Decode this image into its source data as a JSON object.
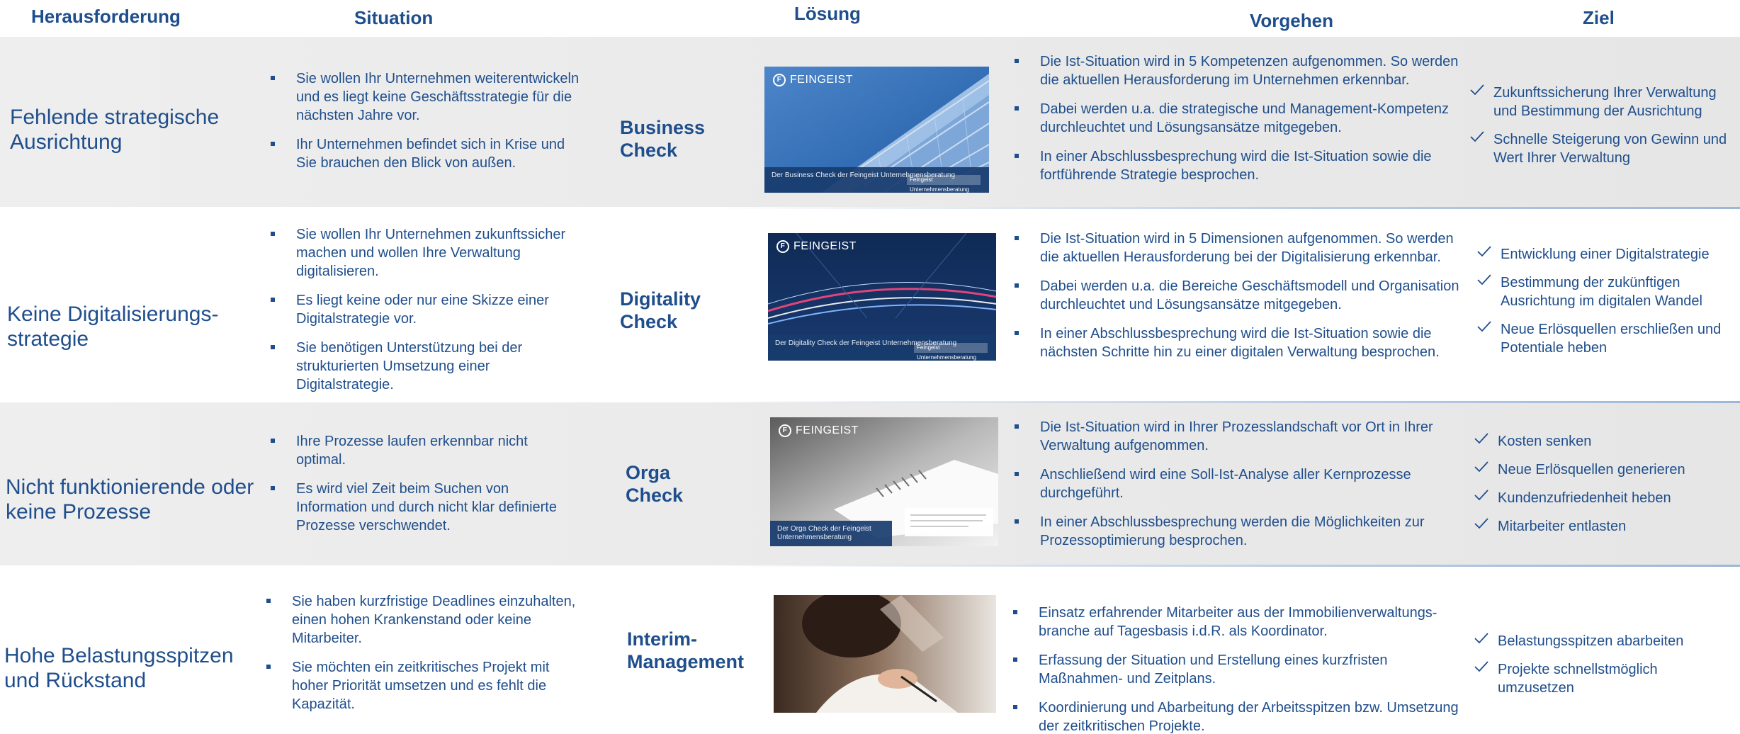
{
  "headers": {
    "challenge": "Herausforderung",
    "situation": "Situation",
    "solution": "Lösung",
    "approach": "Vorgehen",
    "goal": "Ziel"
  },
  "rows": [
    {
      "challenge": "Fehlende strategische Ausrichtung",
      "situation": [
        "Sie wollen Ihr Unternehmen weiterentwickeln und es liegt keine Geschäftsstrategie für die nächsten Jahre vor.",
        "Ihr Unternehmen befindet sich in Krise und Sie brauchen den Blick von außen."
      ],
      "solution": "Business Check",
      "thumbnail": {
        "logo": "FEINGEIST",
        "caption": "Der Business Check der Feingeist Unternehmensberatung",
        "button": "Feingeist Unternehmensberatung"
      },
      "approach": [
        "Die Ist-Situation wird in 5 Kompetenzen aufgenommen. So werden die aktuellen Herausforderung im Unternehmen erkennbar.",
        "Dabei werden u.a. die strategische und Management-Kompetenz durchleuchtet und Lösungsansätze mitgegeben.",
        "In einer Abschlussbesprechung wird die Ist-Situation sowie die fortführende Strategie besprochen."
      ],
      "goals": [
        "Zukunftssicherung Ihrer Verwaltung und Bestimmung der Ausrichtung",
        "Schnelle Steigerung von Gewinn und Wert Ihrer Verwaltung"
      ]
    },
    {
      "challenge": "Keine Digitalisierungs-strategie",
      "situation": [
        "Sie wollen Ihr Unternehmen zukunftssicher machen und wollen Ihre Verwaltung digitalisieren.",
        "Es liegt keine oder nur eine Skizze einer Digitalstrategie vor.",
        "Sie benötigen Unterstützung bei der strukturierten Umsetzung einer Digitalstrategie."
      ],
      "solution": "Digitality Check",
      "thumbnail": {
        "logo": "FEINGEIST",
        "caption": "Der Digitality Check der Feingeist Unternehmensberatung",
        "button": "Feingeist Unternehmensberatung"
      },
      "approach": [
        "Die Ist-Situation wird in 5 Dimensionen aufgenommen. So werden die aktuellen Herausforderung bei der Digitalisierung erkennbar.",
        "Dabei werden u.a. die Bereiche Geschäftsmodell und Organisation durchleuchtet und Lösungsansätze mitgegeben.",
        "In einer Abschlussbesprechung wird die Ist-Situation sowie die nächsten Schritte hin zu einer digitalen Verwaltung besprochen."
      ],
      "goals": [
        "Entwicklung einer Digitalstrategie",
        "Bestimmung der zukünftigen Ausrichtung im digitalen Wandel",
        "Neue Erlösquellen erschließen und Potentiale heben"
      ]
    },
    {
      "challenge": "Nicht funktionierende oder keine Prozesse",
      "situation": [
        "Ihre Prozesse laufen erkennbar nicht optimal.",
        "Es wird viel Zeit beim Suchen von Information und durch nicht klar definierte Prozesse verschwendet."
      ],
      "solution": "Orga Check",
      "thumbnail": {
        "logo": "FEINGEIST",
        "caption": "Der Orga Check der Feingeist Unternehmensberatung",
        "button": ""
      },
      "approach": [
        "Die Ist-Situation wird in Ihrer Prozesslandschaft vor Ort in Ihrer Verwaltung aufgenommen.",
        "Anschließend wird eine Soll-Ist-Analyse aller Kernprozesse durchgeführt.",
        "In einer Abschlussbesprechung werden die Möglichkeiten zur Prozessoptimierung besprochen."
      ],
      "goals": [
        "Kosten senken",
        "Neue Erlösquellen generieren",
        "Kundenzufriedenheit heben",
        "Mitarbeiter entlasten"
      ]
    },
    {
      "challenge": "Hohe Belastungsspitzen und Rückstand",
      "situation": [
        "Sie haben kurzfristige Deadlines einzuhalten, einen hohen Krankenstand oder keine Mitarbeiter.",
        "Sie möchten ein zeitkritisches Projekt mit hoher Priorität umsetzen und es fehlt die Kapazität."
      ],
      "solution": "Interim-Management",
      "approach": [
        "Einsatz erfahrender Mitarbeiter aus der Immobilienverwaltungs-branche auf Tagesbasis i.d.R. als Koordinator.",
        "Erfassung der Situation und Erstellung eines kurzfristen Maßnahmen- und Zeitplans.",
        "Koordinierung und Abarbeitung der Arbeitsspitzen bzw. Umsetzung der zeitkritischen Projekte."
      ],
      "goals": [
        "Belastungsspitzen abarbeiten",
        "Projekte schnellstmöglich umzusetzen"
      ]
    }
  ],
  "colors": {
    "text": "#1f4e8c",
    "band_grey": "#eeeeee",
    "caption_bar": "#183c6e"
  }
}
